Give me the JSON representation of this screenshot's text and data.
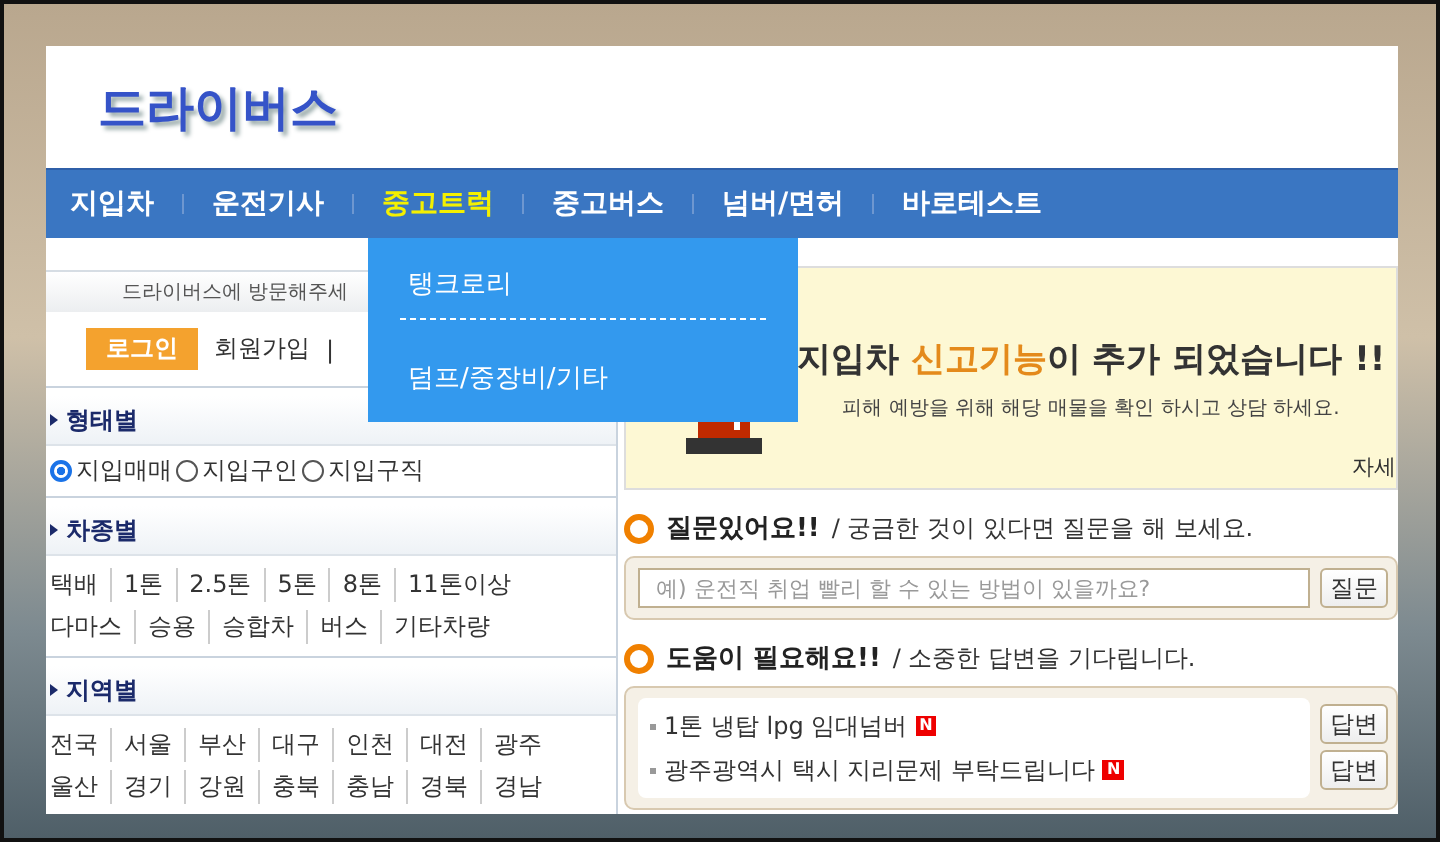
{
  "logo": "드라이버스",
  "nav": [
    {
      "label": "지입차",
      "selected": false
    },
    {
      "label": "운전기사",
      "selected": false
    },
    {
      "label": "중고트럭",
      "selected": true
    },
    {
      "label": "중고버스",
      "selected": false
    },
    {
      "label": "넘버/면허",
      "selected": false
    },
    {
      "label": "바로테스트",
      "selected": false
    }
  ],
  "dropdown": [
    "탱크로리",
    "덤프/중장비/기타"
  ],
  "sidebar": {
    "welcome": "드라이버스에 방문해주세",
    "login": "로그인",
    "signup": "회원가입",
    "separator": "|",
    "sections": [
      {
        "kind": "radio",
        "title": "형태별",
        "options": [
          {
            "label": "지입매매",
            "selected": true
          },
          {
            "label": "지입구인",
            "selected": false
          },
          {
            "label": "지입구직",
            "selected": false
          }
        ]
      },
      {
        "kind": "links",
        "title": "차종별",
        "links": [
          "택배",
          "1톤",
          "2.5톤",
          "5톤",
          "8톤",
          "11톤이상",
          "다마스",
          "승용",
          "승합차",
          "버스",
          "기타차량"
        ]
      },
      {
        "kind": "links",
        "title": "지역별",
        "links": [
          "전국",
          "서울",
          "부산",
          "대구",
          "인천",
          "대전",
          "광주",
          "울산",
          "경기",
          "강원",
          "충북",
          "충남",
          "경북",
          "경남"
        ]
      }
    ]
  },
  "notice": {
    "title_parts": [
      {
        "text": "지입차 ",
        "highlight": false
      },
      {
        "text": "신고기능",
        "highlight": true
      },
      {
        "text": "이 추가 되었습니다 !!",
        "highlight": false
      }
    ],
    "subtitle": "피해 예방을 위해 해당 매물을 확인 하시고 상담 하세요.",
    "more": "자세"
  },
  "question": {
    "title": "질문있어요!!",
    "desc": "/ 궁금한 것이 있다면 질문을 해 보세요.",
    "placeholder": "예) 운전직 취업 빨리 할 수 있는 방법이 있을까요?",
    "button": "질문"
  },
  "help": {
    "title": "도움이 필요해요!!",
    "desc": "/ 소중한 답변을 기다립니다.",
    "items": [
      {
        "text": "1톤 냉탑 lpg 임대넘버",
        "new": true,
        "badge": "N",
        "button": "답변"
      },
      {
        "text": "광주광역시 택시 지리문제 부탁드립니다",
        "new": true,
        "badge": "N",
        "button": "답변"
      }
    ]
  }
}
